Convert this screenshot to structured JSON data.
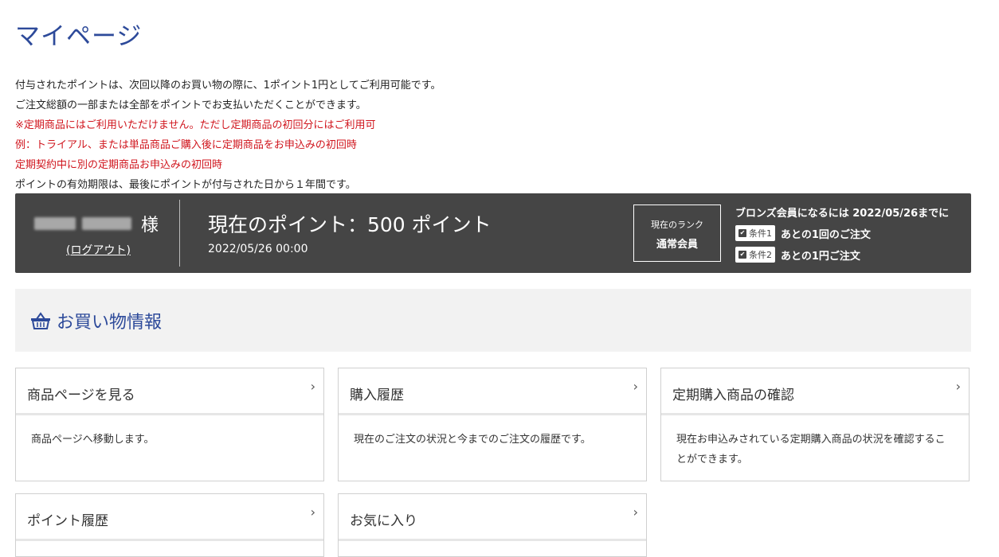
{
  "page": {
    "title": "マイページ"
  },
  "notes": [
    {
      "text": "付与されたポイントは、次回以降のお買い物の際に、1ポイント1円としてご利用可能です。",
      "red": false
    },
    {
      "text": "ご注文総額の一部または全部をポイントでお支払いただくことができます。",
      "red": false
    },
    {
      "text": "※定期商品にはご利用いただけません。ただし定期商品の初回分にはご利用可",
      "red": true
    },
    {
      "text": "例：トライアル、または単品商品ご購入後に定期商品をお申込みの初回時",
      "red": true
    },
    {
      "text": "定期契約中に別の定期商品お申込みの初回時",
      "red": true
    },
    {
      "text": "ポイントの有効期限は、最後にポイントが付与された日から１年間です。",
      "red": false
    }
  ],
  "status": {
    "user_suffix": "様",
    "logout": "(ログアウト)",
    "points_title": "現在のポイント：500 ポイント",
    "points_date": "2022/05/26 00:00",
    "rank_label": "現在のランク",
    "rank_value": "通常会員",
    "condition_heading": "ブロンズ会員になるには 2022/05/26までに",
    "conditions": [
      {
        "badge": "条件1",
        "text": "あとの1回のご注文"
      },
      {
        "badge": "条件2",
        "text": "あとの1円ご注文"
      }
    ]
  },
  "section": {
    "icon": "basket-icon",
    "title": "お買い物情報"
  },
  "cards": [
    {
      "title": "商品ページを見る",
      "desc": "商品ページへ移動します。"
    },
    {
      "title": "購入履歴",
      "desc": "現在のご注文の状況と今までのご注文の履歴です。"
    },
    {
      "title": "定期購入商品の確認",
      "desc": "現在お申込みされている定期購入商品の状況を確認することができます。"
    },
    {
      "title": "ポイント履歴",
      "desc": ""
    },
    {
      "title": "お気に入り",
      "desc": ""
    }
  ],
  "colors": {
    "accent": "#2d4a9a",
    "warning": "#d0151d",
    "bar": "#454545",
    "section_bg": "#f2f2f2"
  },
  "icons": {
    "chevron": "›",
    "check": "✔"
  }
}
